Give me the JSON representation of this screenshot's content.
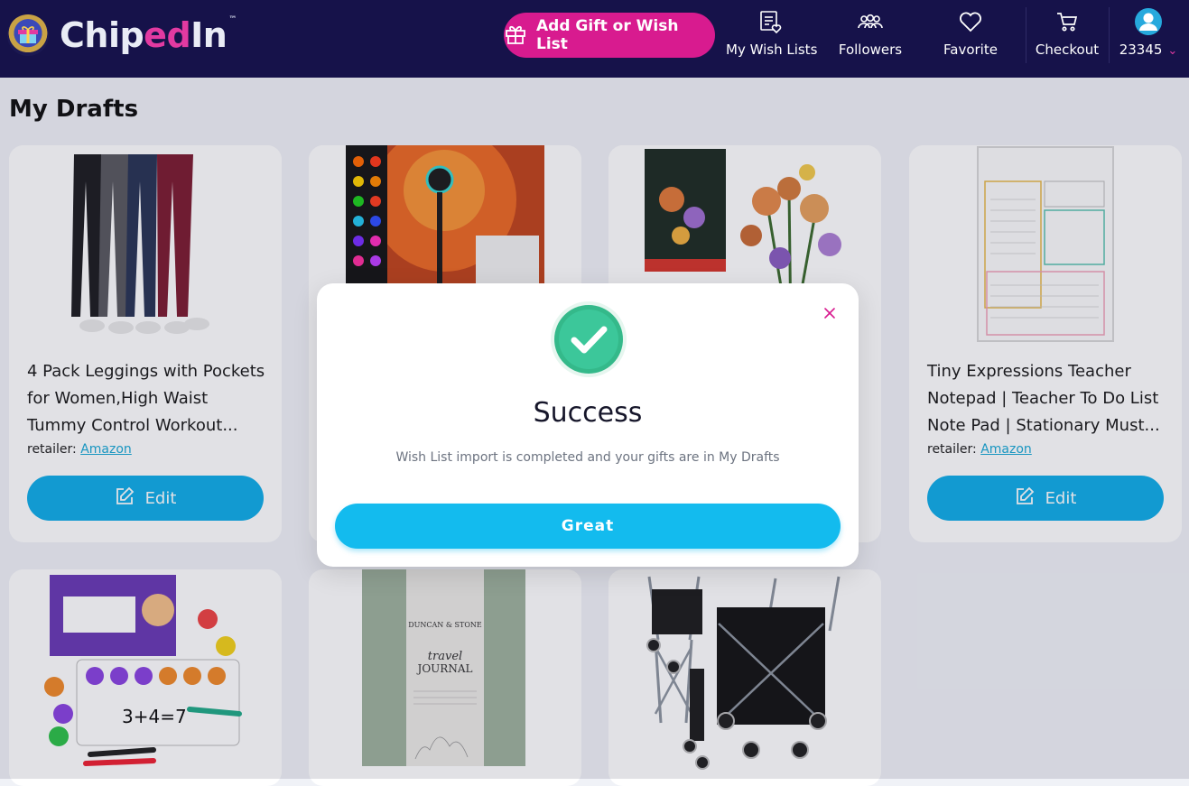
{
  "header": {
    "logo_text_a": "Chip",
    "logo_text_b": "ed",
    "logo_text_c": "In",
    "logo_tm": "™",
    "add_button": "Add Gift or Wish List",
    "nav": {
      "wish_lists": "My Wish Lists",
      "followers": "Followers",
      "favorite": "Favorite",
      "checkout": "Checkout",
      "user": "23345"
    },
    "colors": {
      "bar": "#16124a",
      "accent": "#d81b8f"
    }
  },
  "page": {
    "title": "My Drafts",
    "retailer_label": "retailer:",
    "edit_label": "Edit"
  },
  "cards": [
    {
      "title": "4 Pack Leggings with Pockets for Women,High Waist Tummy Control Workout...",
      "retailer": "Amazon",
      "image": "leggings"
    },
    {
      "title": "",
      "retailer": "",
      "image": "sunset-lamp"
    },
    {
      "title": "",
      "retailer": "",
      "image": "flower-bouquet"
    },
    {
      "title": "Tiny Expressions Teacher Notepad | Teacher To Do List Note Pad | Stationary Must...",
      "retailer": "Amazon",
      "image": "teacher-notepad"
    },
    {
      "image": "magnetic-ten-frame"
    },
    {
      "image": "travel-journal"
    },
    {
      "image": "laundry-cart"
    }
  ],
  "modal": {
    "title": "Success",
    "message": "Wish List import is completed and your gifts are in My Drafts",
    "button": "Great",
    "icon": "check-circle-icon",
    "colors": {
      "check": "#3cc79a",
      "button": "#13bbee"
    }
  }
}
